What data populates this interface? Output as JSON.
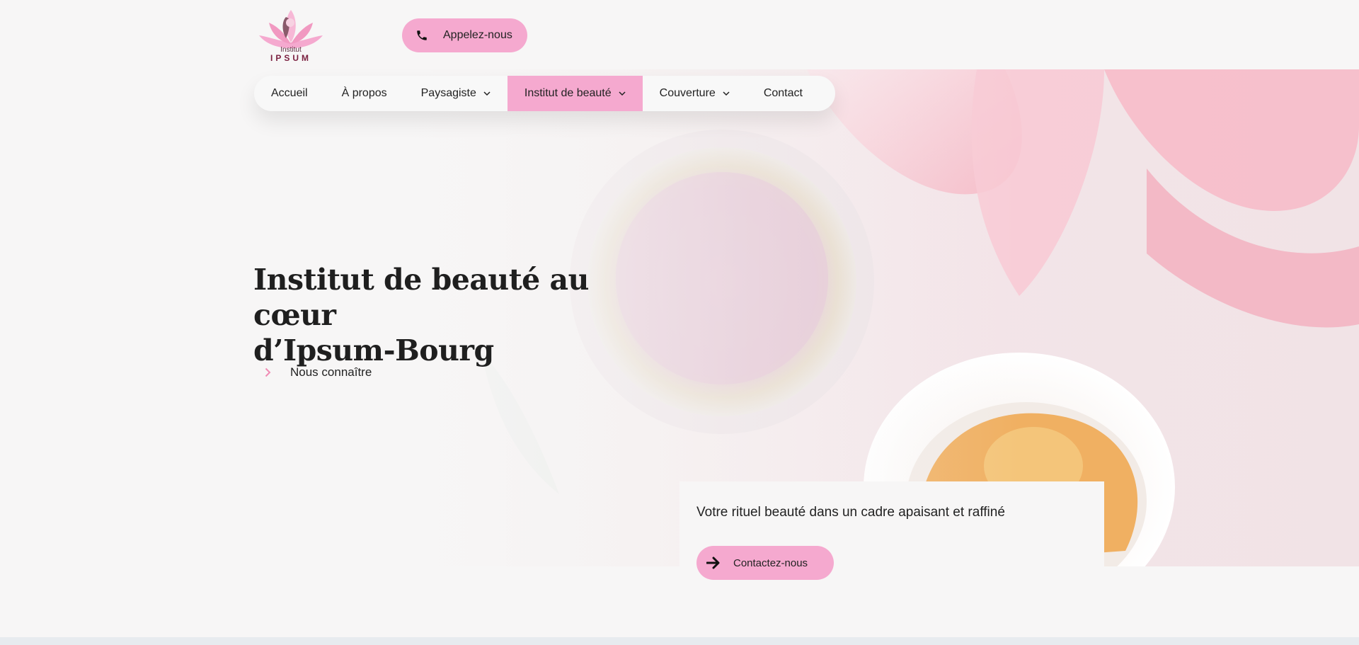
{
  "brand": {
    "logo_line1": "Institut",
    "logo_line2": "IPSUM",
    "accent_color": "#f5a9cf",
    "logo_icon": "lotus-woman-icon"
  },
  "header": {
    "call_button_label": "Appelez-nous",
    "call_icon": "phone-icon"
  },
  "nav": {
    "items": [
      {
        "label": "Accueil",
        "dropdown": false,
        "active": false
      },
      {
        "label": "À propos",
        "dropdown": false,
        "active": false
      },
      {
        "label": "Paysagiste",
        "dropdown": true,
        "active": false
      },
      {
        "label": "Institut de beauté",
        "dropdown": true,
        "active": true
      },
      {
        "label": "Couverture",
        "dropdown": true,
        "active": false
      },
      {
        "label": "Contact",
        "dropdown": false,
        "active": false
      }
    ]
  },
  "hero": {
    "title_line1": "Institut de beauté au cœur",
    "title_line2": "d’Ipsum-Bourg",
    "link_label": "Nous connaître",
    "link_icon": "chevron-right-icon"
  },
  "card": {
    "text": "Votre rituel beauté dans un cadre apaisant et raffiné",
    "button_label": "Contactez-nous",
    "button_icon": "arrow-right-icon"
  }
}
